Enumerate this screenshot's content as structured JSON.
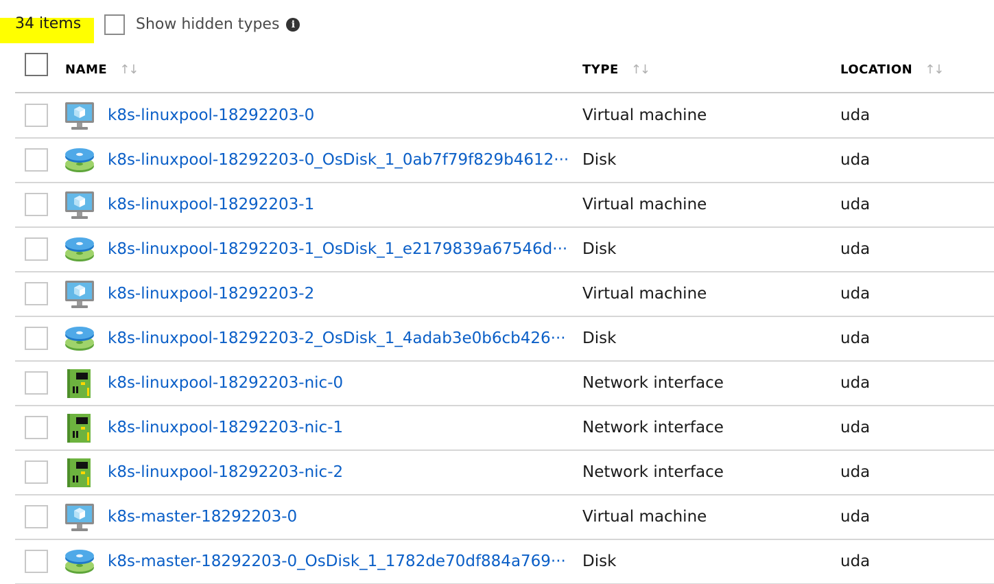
{
  "toolbar": {
    "item_count": "34 items",
    "show_hidden_label": "Show hidden types",
    "info_glyph": "i",
    "highlight_color": "#ffff00"
  },
  "table": {
    "columns": [
      {
        "label": "NAME",
        "sort_icon": "sort-arrows-icon"
      },
      {
        "label": "TYPE",
        "sort_icon": "sort-arrows-icon"
      },
      {
        "label": "LOCATION",
        "sort_icon": "sort-arrows-icon"
      }
    ],
    "sort_glyph": "↑↓",
    "link_color": "#0b5fc7",
    "rows": [
      {
        "name": "k8s-linuxpool-18292203-0",
        "type": "Virtual machine",
        "location": "uda",
        "icon": "virtual-machine-icon"
      },
      {
        "name": "k8s-linuxpool-18292203-0_OsDisk_1_0ab7f79f829b4612···",
        "type": "Disk",
        "location": "uda",
        "icon": "disk-icon"
      },
      {
        "name": "k8s-linuxpool-18292203-1",
        "type": "Virtual machine",
        "location": "uda",
        "icon": "virtual-machine-icon"
      },
      {
        "name": "k8s-linuxpool-18292203-1_OsDisk_1_e2179839a67546d···",
        "type": "Disk",
        "location": "uda",
        "icon": "disk-icon"
      },
      {
        "name": "k8s-linuxpool-18292203-2",
        "type": "Virtual machine",
        "location": "uda",
        "icon": "virtual-machine-icon"
      },
      {
        "name": "k8s-linuxpool-18292203-2_OsDisk_1_4adab3e0b6cb426···",
        "type": "Disk",
        "location": "uda",
        "icon": "disk-icon"
      },
      {
        "name": "k8s-linuxpool-18292203-nic-0",
        "type": "Network interface",
        "location": "uda",
        "icon": "network-interface-icon"
      },
      {
        "name": "k8s-linuxpool-18292203-nic-1",
        "type": "Network interface",
        "location": "uda",
        "icon": "network-interface-icon"
      },
      {
        "name": "k8s-linuxpool-18292203-nic-2",
        "type": "Network interface",
        "location": "uda",
        "icon": "network-interface-icon"
      },
      {
        "name": "k8s-master-18292203-0",
        "type": "Virtual machine",
        "location": "uda",
        "icon": "virtual-machine-icon"
      },
      {
        "name": "k8s-master-18292203-0_OsDisk_1_1782de70df884a769···",
        "type": "Disk",
        "location": "uda",
        "icon": "disk-icon"
      }
    ]
  }
}
